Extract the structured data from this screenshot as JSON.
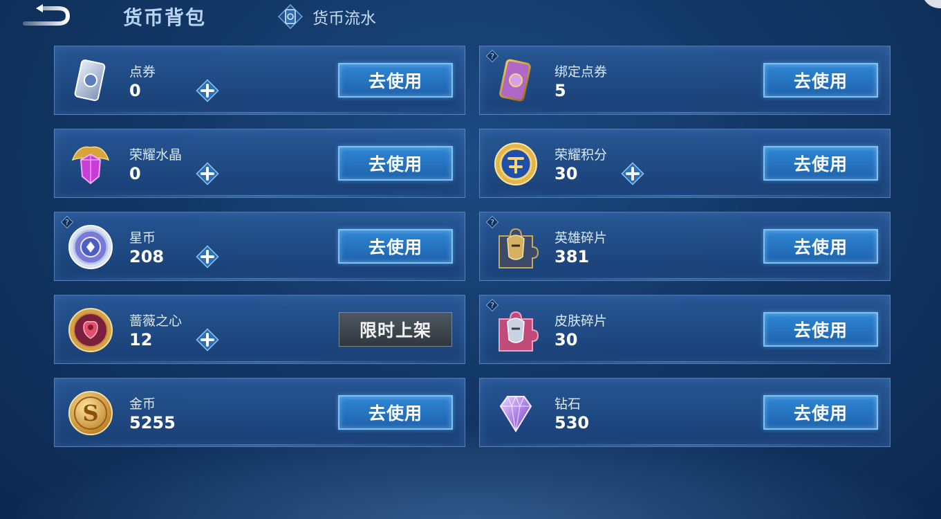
{
  "header": {
    "title": "货币背包",
    "history_label": "货币流水"
  },
  "icons": {
    "back": "back-arrow-icon",
    "history": "ledger-icon",
    "help": "question-icon",
    "add": "plus-icon"
  },
  "colors": {
    "accent_button": "#2f86d4",
    "disabled_button": "#3c444c",
    "background": "#133867"
  },
  "currencies": [
    {
      "name": "点券",
      "amount": "0",
      "button": "去使用",
      "icon": "voucher-card-icon",
      "has_add": true,
      "has_help": false
    },
    {
      "name": "绑定点券",
      "amount": "5",
      "button": "去使用",
      "icon": "bound-voucher-card-icon",
      "has_add": false,
      "has_help": true
    },
    {
      "name": "荣耀水晶",
      "amount": "0",
      "button": "去使用",
      "icon": "glory-crystal-icon",
      "has_add": true,
      "has_help": false
    },
    {
      "name": "荣耀积分",
      "amount": "30",
      "button": "去使用",
      "icon": "glory-points-icon",
      "has_add": true,
      "has_help": false
    },
    {
      "name": "星币",
      "amount": "208",
      "button": "去使用",
      "icon": "star-coin-icon",
      "has_add": true,
      "has_help": true
    },
    {
      "name": "英雄碎片",
      "amount": "381",
      "button": "去使用",
      "icon": "hero-fragment-icon",
      "has_add": false,
      "has_help": true
    },
    {
      "name": "蔷薇之心",
      "amount": "12",
      "button": "限时上架",
      "icon": "rose-heart-icon",
      "has_add": true,
      "has_help": false
    },
    {
      "name": "皮肤碎片",
      "amount": "30",
      "button": "去使用",
      "icon": "skin-fragment-icon",
      "has_add": false,
      "has_help": true
    },
    {
      "name": "金币",
      "amount": "5255",
      "button": "去使用",
      "icon": "gold-coin-icon",
      "has_add": false,
      "has_help": false
    },
    {
      "name": "钻石",
      "amount": "530",
      "button": "去使用",
      "icon": "diamond-icon",
      "has_add": false,
      "has_help": false
    }
  ]
}
